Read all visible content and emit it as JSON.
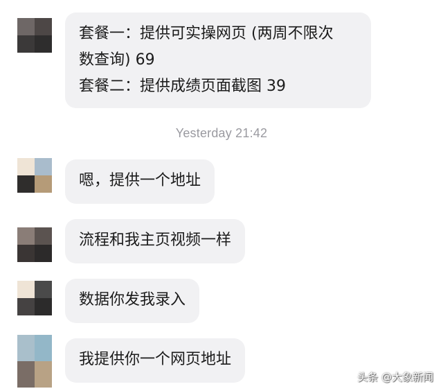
{
  "messages": [
    {
      "lines": [
        "套餐一：提供可实操网页 (两周不限次",
        "数查询) 69",
        "套餐二：提供成绩页面截图 39"
      ]
    },
    {
      "lines": [
        "嗯，提供一个地址"
      ]
    },
    {
      "lines": [
        "流程和我主页视频一样"
      ]
    },
    {
      "lines": [
        "数据你发我录入"
      ]
    },
    {
      "lines": [
        "我提供你一个网页地址"
      ]
    }
  ],
  "timestamp": "Yesterday 21:42",
  "watermark": "头条 @大象新闻",
  "colors": {
    "bubble": "#f1f1f3",
    "timestamp": "#9a9aa0"
  }
}
